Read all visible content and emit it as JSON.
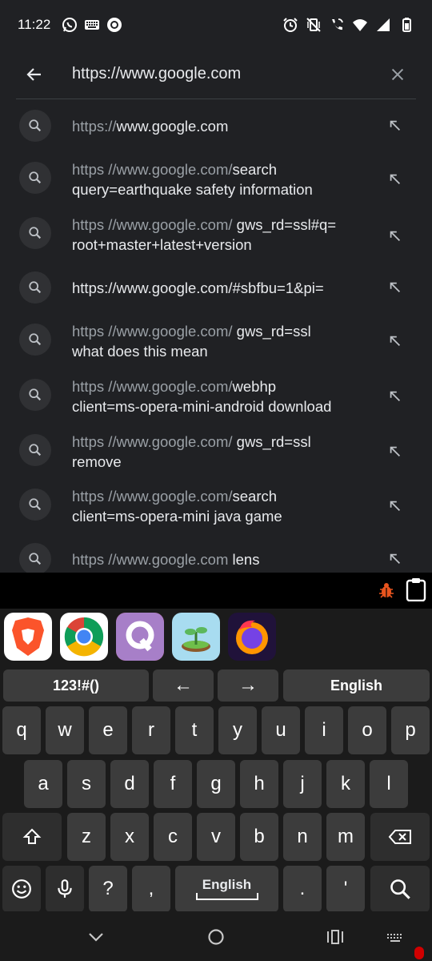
{
  "status_bar": {
    "time": "11:22",
    "left_icons": [
      "whatsapp-icon",
      "keyboard-icon",
      "circle-app-icon"
    ],
    "right_icons": [
      "alarm-icon",
      "vibrate-icon",
      "call-wifi-icon",
      "wifi-icon",
      "signal-icon",
      "battery-icon"
    ]
  },
  "url_bar": {
    "text": "https://www.google.com"
  },
  "suggestions": [
    {
      "line1_prefix": "https://",
      "line1_main": "www.google.com",
      "line2": ""
    },
    {
      "line1_prefix": "https //www.google.com/",
      "line1_main": "search",
      "line2": "query=earthquake safety information"
    },
    {
      "line1_prefix": "https //www.google.com/",
      "line1_main": " gws_rd=ssl#q=",
      "line2": "root+master+latest+version"
    },
    {
      "line1_prefix": "",
      "line1_main": "https://www.google.com/#sbfbu=1&pi=",
      "line2": ""
    },
    {
      "line1_prefix": "https //www.google.com/",
      "line1_main": " gws_rd=ssl",
      "line2": "what does this mean"
    },
    {
      "line1_prefix": "https //www.google.com/",
      "line1_main": "webhp",
      "line2": "client=ms-opera-mini-android download"
    },
    {
      "line1_prefix": "https //www.google.com/",
      "line1_main": " gws_rd=ssl",
      "line2": "remove"
    },
    {
      "line1_prefix": "https //www.google.com/",
      "line1_main": "search",
      "line2": "client=ms-opera-mini java game"
    },
    {
      "line1_prefix": "https //www.google.com ",
      "line1_main": "lens",
      "line2": ""
    }
  ],
  "keyboard": {
    "toolbar": {
      "bug_icon": "bug-icon",
      "clipboard_icon": "clipboard-icon"
    },
    "apps": [
      {
        "name": "brave-app-icon",
        "bg": "#ffffff"
      },
      {
        "name": "chrome-app-icon",
        "bg": "#ffffff"
      },
      {
        "name": "quora-app-icon",
        "bg": "#b92b27"
      },
      {
        "name": "plant-app-icon",
        "bg": "#a8dcf0"
      },
      {
        "name": "firefox-app-icon",
        "bg": "#20123a"
      }
    ],
    "top_row": {
      "symbols": "123!#()",
      "left_arrow": "←",
      "right_arrow": "→",
      "language": "English"
    },
    "row1": [
      "q",
      "w",
      "e",
      "r",
      "t",
      "y",
      "u",
      "i",
      "o",
      "p"
    ],
    "row2": [
      "a",
      "s",
      "d",
      "f",
      "g",
      "h",
      "j",
      "k",
      "l"
    ],
    "row3": [
      "z",
      "x",
      "c",
      "v",
      "b",
      "n",
      "m"
    ],
    "row4": {
      "question": "?",
      "comma": ",",
      "space": "English",
      "period": ".",
      "apostrophe": "'"
    }
  },
  "colors": {
    "background": "#202124",
    "keyboard_bg": "#1b1b1b",
    "key_bg": "#3c3c3c",
    "accent_bug": "#e8541e"
  }
}
